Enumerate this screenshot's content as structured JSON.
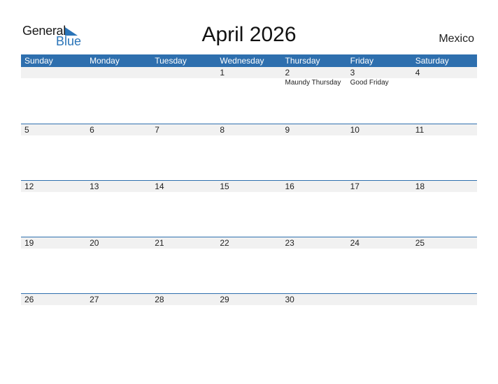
{
  "logo": {
    "general": "General",
    "blue": "Blue"
  },
  "title": "April 2026",
  "country": "Mexico",
  "weekdays": [
    "Sunday",
    "Monday",
    "Tuesday",
    "Wednesday",
    "Thursday",
    "Friday",
    "Saturday"
  ],
  "weeks": [
    {
      "days": [
        "",
        "",
        "",
        "1",
        "2",
        "3",
        "4"
      ],
      "events": [
        "",
        "",
        "",
        "",
        "Maundy Thursday",
        "Good Friday",
        ""
      ]
    },
    {
      "days": [
        "5",
        "6",
        "7",
        "8",
        "9",
        "10",
        "11"
      ],
      "events": [
        "",
        "",
        "",
        "",
        "",
        "",
        ""
      ]
    },
    {
      "days": [
        "12",
        "13",
        "14",
        "15",
        "16",
        "17",
        "18"
      ],
      "events": [
        "",
        "",
        "",
        "",
        "",
        "",
        ""
      ]
    },
    {
      "days": [
        "19",
        "20",
        "21",
        "22",
        "23",
        "24",
        "25"
      ],
      "events": [
        "",
        "",
        "",
        "",
        "",
        "",
        ""
      ]
    },
    {
      "days": [
        "26",
        "27",
        "28",
        "29",
        "30",
        "",
        ""
      ],
      "events": [
        "",
        "",
        "",
        "",
        "",
        "",
        ""
      ]
    }
  ]
}
